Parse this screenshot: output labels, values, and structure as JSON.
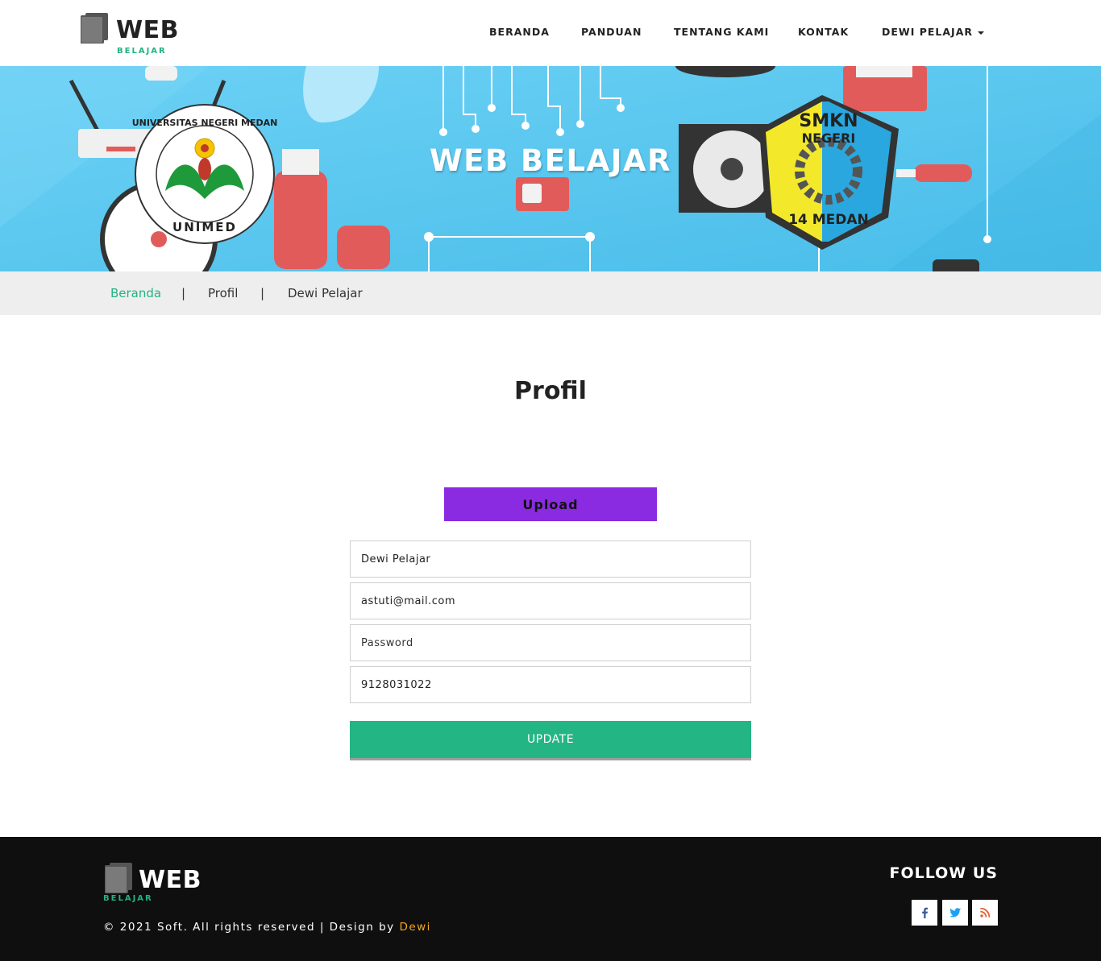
{
  "brand": {
    "word": "WEB",
    "sub": "BELAJAR"
  },
  "nav": {
    "items": [
      "BERANDA",
      "PANDUAN",
      "TENTANG KAMI",
      "KONTAK"
    ],
    "user": "DEWI PELAJAR"
  },
  "banner": {
    "title": "WEB BELAJAR",
    "logo_left_text_top": "UNIVERSITAS NEGERI MEDAN",
    "logo_left_text_bottom": "UNIMED",
    "logo_right_line1": "SMKN",
    "logo_right_line2": "NEGERI",
    "logo_right_line3": "14 MEDAN"
  },
  "breadcrumb": {
    "home": "Beranda",
    "sep": "|",
    "section": "Profil",
    "current": "Dewi Pelajar"
  },
  "main": {
    "title": "Profil",
    "upload_label": "Upload",
    "form": {
      "name_value": "Dewi Pelajar",
      "email_value": "astuti@mail.com",
      "password_placeholder": "Password",
      "phone_value": "9128031022",
      "update_label": "UPDATE"
    }
  },
  "footer": {
    "brand_word": "WEB",
    "brand_sub": "BELAJAR",
    "copyright_prefix": "© 2021 Soft. All rights reserved | Design by ",
    "designer": "Dewi",
    "follow_title": "FOLLOW US",
    "social_icons": [
      "facebook-icon",
      "twitter-icon",
      "rss-icon"
    ]
  },
  "colors": {
    "accent_green": "#22b37f",
    "upload_purple": "#8a2be2",
    "update_green": "#24b584",
    "banner_blue": "#5ac8f2",
    "footer_bg": "#0f0f0f",
    "designer_orange": "#f5a623"
  }
}
